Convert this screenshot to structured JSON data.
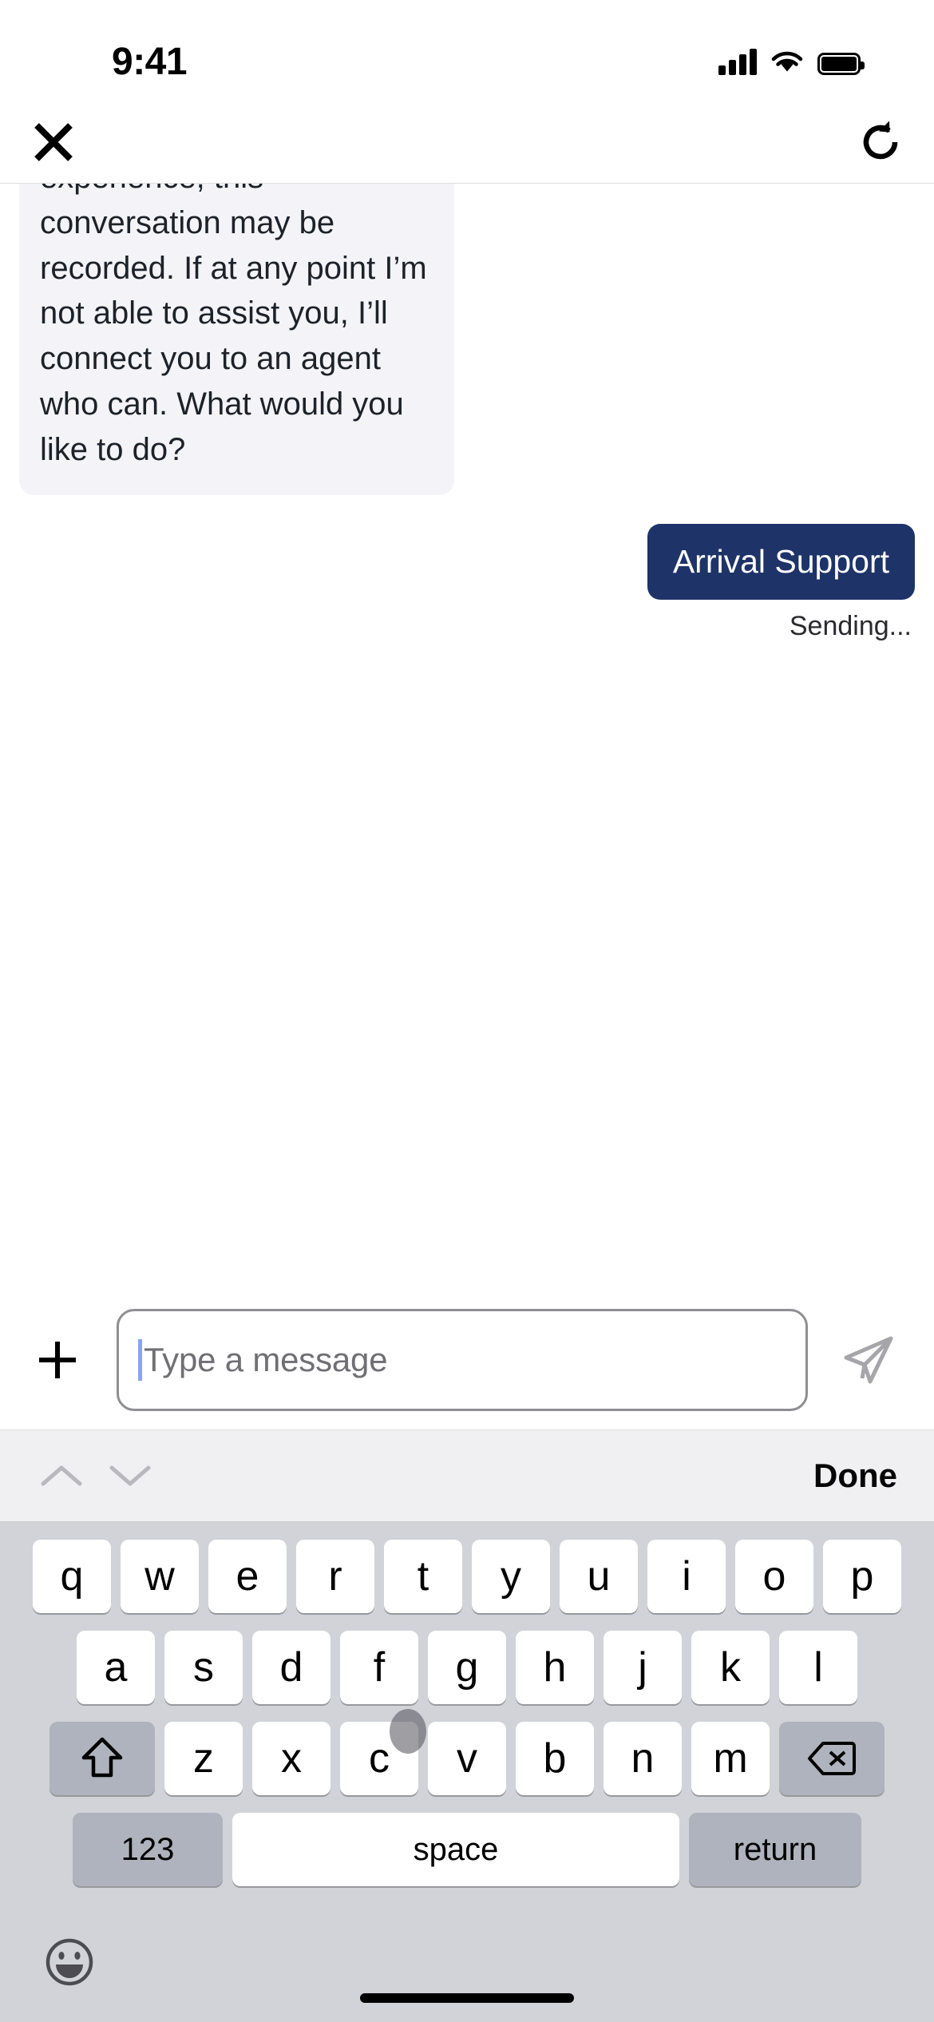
{
  "status_bar": {
    "time": "9:41",
    "cellular_icon": "cellular-bars-icon",
    "wifi_icon": "wifi-icon",
    "battery_icon": "battery-full-icon"
  },
  "nav_bar": {
    "close_icon": "close-x-icon",
    "refresh_icon": "refresh-icon"
  },
  "chat": {
    "messages": [
      {
        "sender": "bot",
        "text": "experience, this conversation may be recorded. If at any point I’m not able to assist you, I’ll connect you to an agent who can. What would you like to do?",
        "clipped_top": true
      },
      {
        "sender": "user",
        "text": "Arrival Support",
        "status": "Sending..."
      }
    ],
    "bot_bubble_bg": "#f4f4f8",
    "user_bubble_bg": "#1e3368",
    "user_bubble_text_color": "#ffffff"
  },
  "input_bar": {
    "add_icon": "plus-icon",
    "placeholder": "Type a message",
    "value": "",
    "caret_color": "#8ba3f0",
    "send_icon": "send-paper-plane-icon"
  },
  "keyboard_accessory": {
    "prev_icon": "chevron-up-icon",
    "next_icon": "chevron-down-icon",
    "done_label": "Done"
  },
  "keyboard": {
    "row1": [
      "q",
      "w",
      "e",
      "r",
      "t",
      "y",
      "u",
      "i",
      "o",
      "p"
    ],
    "row2": [
      "a",
      "s",
      "d",
      "f",
      "g",
      "h",
      "j",
      "k",
      "l"
    ],
    "row3_letters": [
      "z",
      "x",
      "c",
      "v",
      "b",
      "n",
      "m"
    ],
    "shift_icon": "shift-arrow-icon",
    "backspace_icon": "backspace-delete-icon",
    "numbers_label": "123",
    "space_label": "space",
    "return_label": "return",
    "emoji_icon": "emoji-smiley-icon",
    "background_color": "#d1d3d9",
    "key_color": "#ffffff",
    "modifier_key_color": "#aeb3bd"
  },
  "home_indicator": "home-indicator-bar"
}
